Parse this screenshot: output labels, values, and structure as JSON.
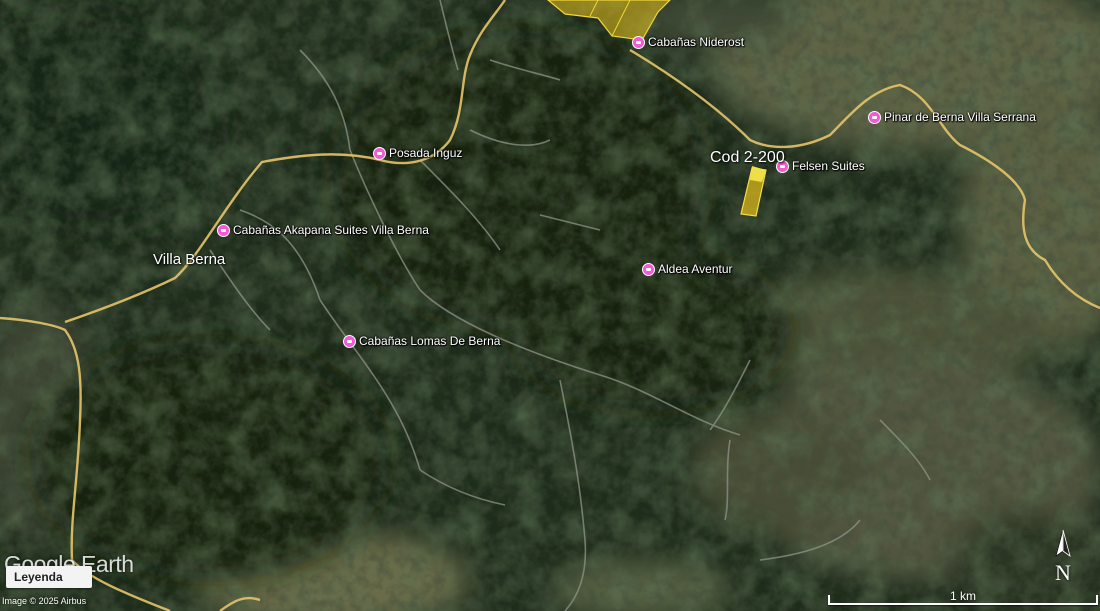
{
  "map": {
    "place_label": "Villa Berna",
    "parcel_label": "Cod 2-200",
    "pois": [
      {
        "id": "cabanas-niderost",
        "label": "Cabañas Niderost"
      },
      {
        "id": "pinar-de-berna",
        "label": "Pinar de Berna Villa Serrana"
      },
      {
        "id": "felsen-suites",
        "label": "Felsen Suites"
      },
      {
        "id": "posada-inguz",
        "label": "Posada Inguz"
      },
      {
        "id": "cabanas-akapana",
        "label": "Cabañas Akapana Suites Villa Berna"
      },
      {
        "id": "aldea-aventur",
        "label": "Aldea Aventur"
      },
      {
        "id": "cabanas-lomas",
        "label": "Cabañas Lomas De Berna"
      }
    ],
    "poi_icon": "hotel-icon",
    "poi_color": "#f25ad6",
    "road_color": "#e5c46a",
    "parcel_color": "#e8c21c"
  },
  "overlay": {
    "logo_text": "Google Earth",
    "legend_button": "Leyenda",
    "credit": "Image © 2025 Airbus",
    "scale_label": "1 km",
    "compass_label": "N"
  }
}
